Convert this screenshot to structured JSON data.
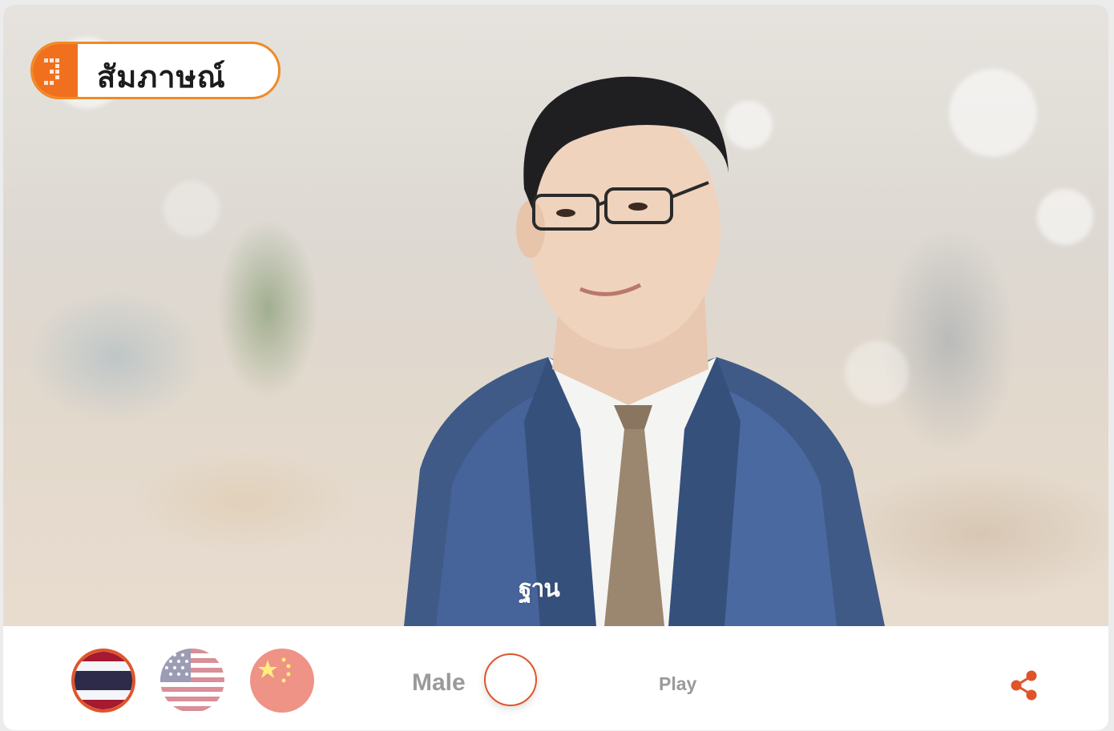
{
  "badge": {
    "label": "สัมภาษณ์",
    "accent_color": "#f0701d"
  },
  "watermark": {
    "text": "ฐาน"
  },
  "languages": [
    {
      "name": "thai-flag-icon",
      "selected": true
    },
    {
      "name": "us-flag-icon",
      "selected": false
    },
    {
      "name": "china-flag-icon",
      "selected": false
    }
  ],
  "voice": {
    "label": "Male"
  },
  "player": {
    "play_label": "Play"
  },
  "share": {
    "icon": "share-icon",
    "color": "#e0542a"
  }
}
